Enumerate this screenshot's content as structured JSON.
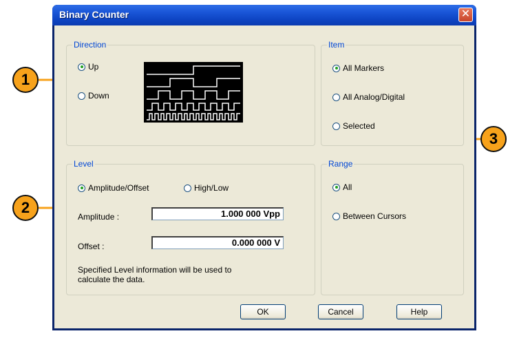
{
  "window": {
    "title": "Binary Counter",
    "close_glyph": "✕"
  },
  "direction": {
    "label": "Direction",
    "options": [
      {
        "label": "Up",
        "selected": true
      },
      {
        "label": "Down",
        "selected": false
      }
    ]
  },
  "item": {
    "label": "Item",
    "options": [
      {
        "label": "All Markers",
        "selected": true
      },
      {
        "label": "All Analog/Digital",
        "selected": false
      },
      {
        "label": "Selected",
        "selected": false
      }
    ]
  },
  "level": {
    "label": "Level",
    "options": [
      {
        "label": "Amplitude/Offset",
        "selected": true
      },
      {
        "label": "High/Low",
        "selected": false
      }
    ],
    "amplitude_label": "Amplitude :",
    "amplitude_value": "1.000 000 Vpp",
    "offset_label": "Offset :",
    "offset_value": "0.000 000 V",
    "note": "Specified Level information will be used to calculate the data."
  },
  "range": {
    "label": "Range",
    "options": [
      {
        "label": "All",
        "selected": true
      },
      {
        "label": "Between Cursors",
        "selected": false
      }
    ]
  },
  "buttons": {
    "ok": "OK",
    "cancel": "Cancel",
    "help": "Help"
  },
  "callouts": [
    "1",
    "2",
    "3"
  ],
  "colors": {
    "callout": "#f7a21b",
    "legend": "#0046d5",
    "title_bar": "#1a56d8"
  }
}
